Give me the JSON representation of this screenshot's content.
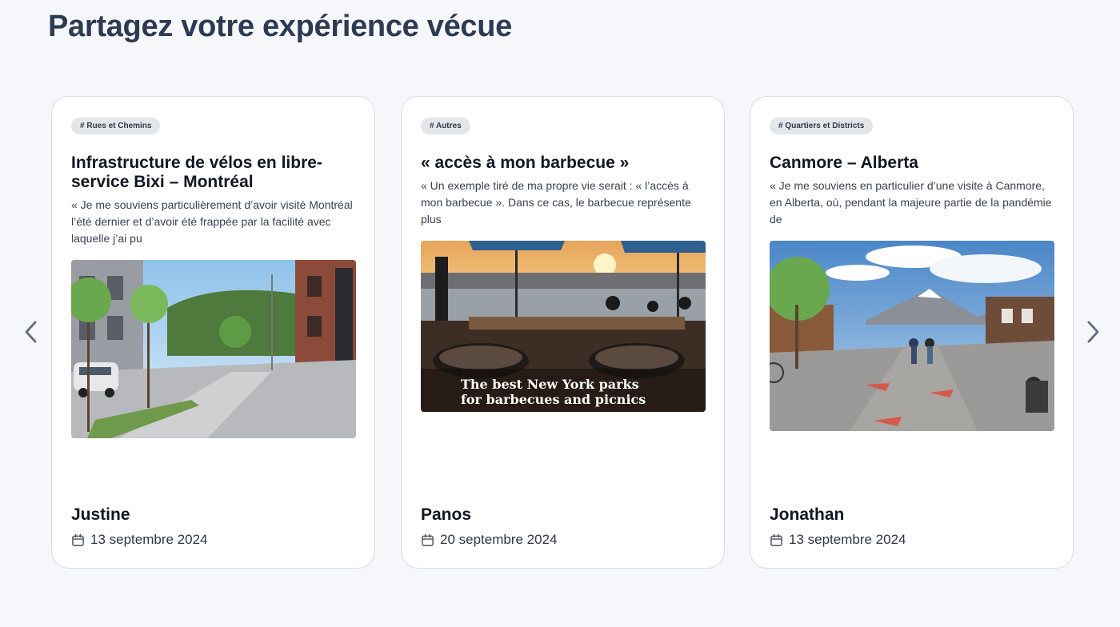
{
  "page_title": "Partagez votre expérience vécue",
  "navigation": {
    "prev_icon": "chevron-left-icon",
    "next_icon": "chevron-right-icon"
  },
  "cards": [
    {
      "tag": "# Rues et Chemins",
      "title": "Infrastructure de vélos en libre-service Bixi – Montréal",
      "excerpt": "« Je me souviens particulièrement d’avoir visité Montréal l’été dernier et d’avoir été frappée par la facilité avec laquelle j’ai pu",
      "image_icon": "street-photo",
      "author": "Justine",
      "date": "13 septembre 2024"
    },
    {
      "tag": "# Autres",
      "title": "« accès à mon barbecue »",
      "excerpt": "« Un exemple tiré de ma propre vie serait : « l’accès à mon barbecue ». Dans ce cas, le barbecue représente plus",
      "image_icon": "barbecue-photo",
      "image_caption": "The best New York parks for barbecues and picnics",
      "author": "Panos",
      "date": "20 septembre 2024"
    },
    {
      "tag": "# Quartiers et Districts",
      "title": "Canmore – Alberta",
      "excerpt": "« Je me souviens en particulier d’une visite à Canmore, en Alberta, où, pendant la majeure partie de la pandémie de",
      "image_icon": "mountain-street-photo",
      "author": "Jonathan",
      "date": "13 septembre 2024"
    }
  ],
  "colors": {
    "background": "#f5f7fa",
    "title": "#2f3a52",
    "card_border": "#d9dde4",
    "tag_bg": "#e4e6ea"
  }
}
